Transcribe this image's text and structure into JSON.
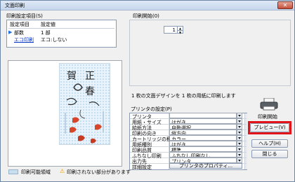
{
  "window": {
    "title": "文面印刷",
    "close_glyph": "✕"
  },
  "settings": {
    "group_label": "印刷設定項目(S)",
    "col_item": "設定項目",
    "col_value": "設定値",
    "rows": [
      {
        "name": "部数",
        "value": "1 部"
      },
      {
        "name": "エコ印刷",
        "value": "エコ:しない"
      }
    ]
  },
  "start_position": {
    "label": "印刷開始(0)",
    "value": "1",
    "up": "▲",
    "down": "▼"
  },
  "info_text": "1 枚の文面デザインを 1 枚の用紙に印刷します",
  "printer_settings": {
    "label": "プリンタの設定(P)",
    "rows": [
      {
        "key": "プリンタ",
        "value": ""
      },
      {
        "key": "用紙・サイズ",
        "value": "はがき"
      },
      {
        "key": "給紙方法",
        "value": "自動選択"
      },
      {
        "key": "印刷の向き",
        "value": "縦方向"
      },
      {
        "key": "カートリッジの種類",
        "value": "カラー"
      },
      {
        "key": "用紙種別",
        "value": "はがき"
      },
      {
        "key": "印刷品質",
        "value": "標準"
      },
      {
        "key": "ふちなし印刷",
        "value": "ふちなし印刷なし"
      },
      {
        "key": "出力先",
        "value": "プリンタ"
      },
      {
        "key": "詳細設定",
        "value": ""
      }
    ],
    "properties_button": "プリンタのプロパティ..."
  },
  "buttons": {
    "print": "印刷開始",
    "preview": "プレビュー(V)",
    "help": "ヘルプ(H)",
    "close": "閉じる"
  },
  "legend": {
    "printable_area": "印刷可能領域",
    "warning": "印刷されない部分があります"
  },
  "card": {
    "text_line1": "賀",
    "text_line2": "正",
    "text_line3": "春",
    "icon": "new-year-card-thumbnail"
  },
  "colors": {
    "highlight": "#e2141a",
    "accent_link": "#0033cc",
    "info_icon": "#1f6fe0"
  }
}
